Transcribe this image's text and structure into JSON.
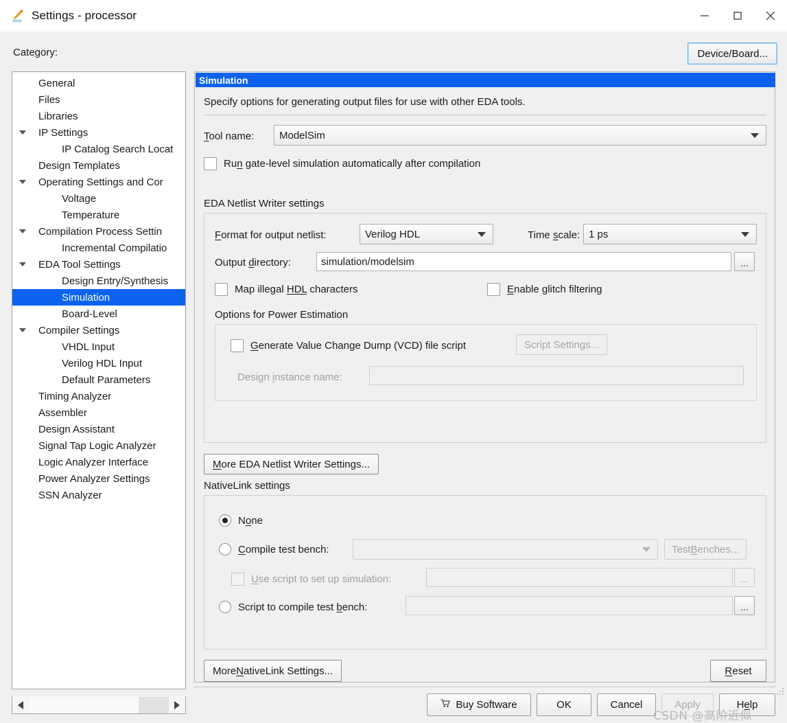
{
  "window": {
    "title": "Settings - processor",
    "icon": "pencil-icon",
    "controls": {
      "minimize": "minimize-icon",
      "maximize": "maximize-icon",
      "close": "close-icon"
    }
  },
  "sidebar": {
    "label": "Category:",
    "selected": "Simulation",
    "items": [
      {
        "label": "General",
        "indent": 0,
        "twisty": false
      },
      {
        "label": "Files",
        "indent": 0,
        "twisty": false
      },
      {
        "label": "Libraries",
        "indent": 0,
        "twisty": false
      },
      {
        "label": "IP Settings",
        "indent": 0,
        "twisty": true
      },
      {
        "label": "IP Catalog Search Locat",
        "indent": 1,
        "twisty": false
      },
      {
        "label": "Design Templates",
        "indent": 0,
        "twisty": false
      },
      {
        "label": "Operating Settings and Cor",
        "indent": 0,
        "twisty": true
      },
      {
        "label": "Voltage",
        "indent": 1,
        "twisty": false
      },
      {
        "label": "Temperature",
        "indent": 1,
        "twisty": false
      },
      {
        "label": "Compilation Process Settin",
        "indent": 0,
        "twisty": true
      },
      {
        "label": "Incremental Compilatio",
        "indent": 1,
        "twisty": false
      },
      {
        "label": "EDA Tool Settings",
        "indent": 0,
        "twisty": true
      },
      {
        "label": "Design Entry/Synthesis",
        "indent": 1,
        "twisty": false
      },
      {
        "label": "Simulation",
        "indent": 1,
        "twisty": false,
        "selected": true
      },
      {
        "label": "Board-Level",
        "indent": 1,
        "twisty": false
      },
      {
        "label": "Compiler Settings",
        "indent": 0,
        "twisty": true
      },
      {
        "label": "VHDL Input",
        "indent": 1,
        "twisty": false
      },
      {
        "label": "Verilog HDL Input",
        "indent": 1,
        "twisty": false
      },
      {
        "label": "Default Parameters",
        "indent": 1,
        "twisty": false
      },
      {
        "label": "Timing Analyzer",
        "indent": 0,
        "twisty": false
      },
      {
        "label": "Assembler",
        "indent": 0,
        "twisty": false
      },
      {
        "label": "Design Assistant",
        "indent": 0,
        "twisty": false
      },
      {
        "label": "Signal Tap Logic Analyzer",
        "indent": 0,
        "twisty": false
      },
      {
        "label": "Logic Analyzer Interface",
        "indent": 0,
        "twisty": false
      },
      {
        "label": "Power Analyzer Settings",
        "indent": 0,
        "twisty": false
      },
      {
        "label": "SSN Analyzer",
        "indent": 0,
        "twisty": false
      }
    ]
  },
  "header": {
    "device_board_label": "Device/Board..."
  },
  "panel": {
    "title": "Simulation",
    "description": "Specify options for generating output files for use with other EDA tools.",
    "tool_name_label_pre": "T",
    "tool_name_label_post": "ool name:",
    "tool_name_value": "ModelSim",
    "run_gate_pre": "Ru",
    "run_gate_mn": "n",
    "run_gate_post": " gate-level simulation automatically after compilation",
    "run_gate_checked": false
  },
  "eda": {
    "group_title": "EDA Netlist Writer settings",
    "format_label_mn": "F",
    "format_label_post": "ormat for output netlist:",
    "format_value": "Verilog HDL",
    "timescale_label_pre": "Time ",
    "timescale_label_mn": "s",
    "timescale_label_post": "cale:",
    "timescale_value": "1 ps",
    "outdir_label_pre": "Output ",
    "outdir_label_mn": "d",
    "outdir_label_post": "irectory:",
    "outdir_value": "simulation/modelsim",
    "browse_label": "...",
    "map_illegal_pre": "Map illegal ",
    "map_illegal_mn": "HDL",
    "map_illegal_post": " characters",
    "map_illegal_checked": false,
    "glitch_mn": "E",
    "glitch_post": "nable glitch filtering",
    "glitch_checked": false,
    "power_title": "Options for Power Estimation",
    "vcd_mn": "G",
    "vcd_post": "enerate Value Change Dump (VCD) file script",
    "vcd_checked": false,
    "script_settings_label": "Script Settings...",
    "script_settings_enabled": false,
    "design_instance_pre": "Design ",
    "design_instance_mn": "i",
    "design_instance_post": "nstance name:",
    "design_instance_value": "",
    "design_instance_enabled": false,
    "more_settings_mn": "M",
    "more_settings_post": "ore EDA Netlist Writer Settings..."
  },
  "nativelink": {
    "group_title": "NativeLink settings",
    "selected": "None",
    "none_pre": "N",
    "none_mn": "o",
    "none_post": "ne",
    "compile_tb_mn": "C",
    "compile_tb_post": "ompile test bench:",
    "compile_tb_value": "",
    "test_benches_pre": "Test ",
    "test_benches_mn": "B",
    "test_benches_post": "enches...",
    "test_benches_enabled": false,
    "use_script_mn": "U",
    "use_script_post": "se script to set up simulation:",
    "use_script_checked": false,
    "use_script_enabled": false,
    "use_script_value": "",
    "script_tb_pre": "Script to compile test ",
    "script_tb_mn": "b",
    "script_tb_post": "ench:",
    "script_tb_value": "",
    "browse_label": "...",
    "more_settings_pre": "More ",
    "more_settings_mn": "N",
    "more_settings_post": "ativeLink Settings...",
    "reset_mn": "R",
    "reset_post": "eset"
  },
  "footer": {
    "buy_label": "Buy Software",
    "buy_icon": "shopping-cart-icon",
    "ok_label": "OK",
    "cancel_label": "Cancel",
    "apply_label": "Apply",
    "apply_enabled": false,
    "help_pre": "H",
    "help_mn": "e",
    "help_post": "lp"
  },
  "watermark": "CSDN @高阶近似",
  "colors": {
    "selection_blue": "#0a62ef",
    "panel_bg": "#f0f0f0",
    "focus_border": "#64b0e8",
    "disabled_text": "#a5a5a5"
  }
}
